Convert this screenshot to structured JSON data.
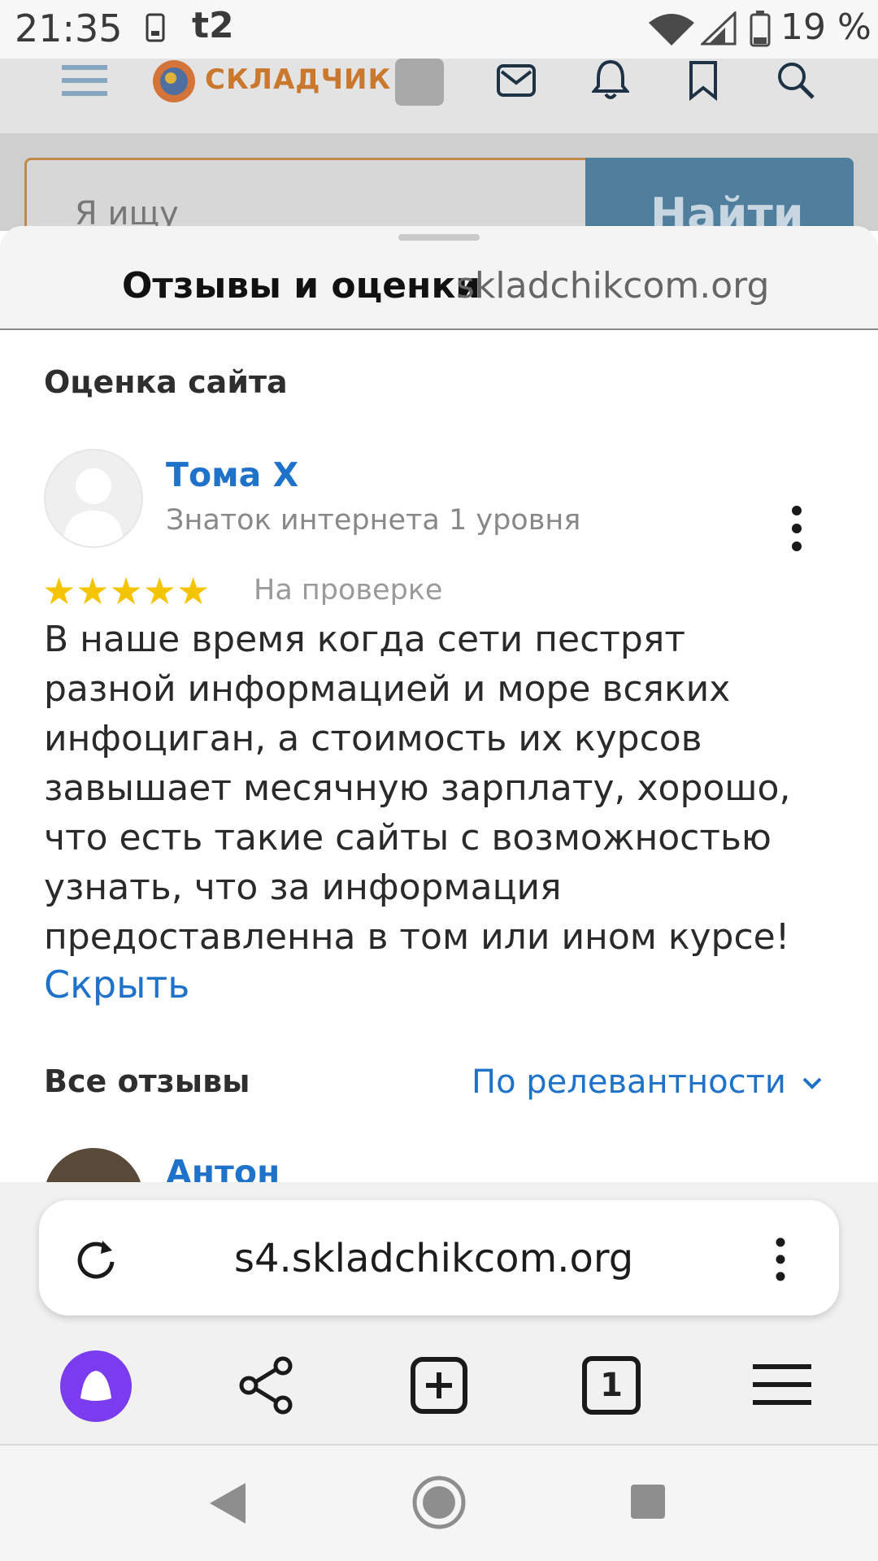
{
  "status_bar": {
    "time": "21:35",
    "carrier": "t2",
    "battery": "19 %"
  },
  "site": {
    "logo_text": "СКЛАДЧИК",
    "search_placeholder": "Я ищу",
    "search_button": "Найти"
  },
  "sheet": {
    "title": "Отзывы и оценки",
    "domain": "skladchikcom.org",
    "rating_section_title": "Оценка сайта",
    "review": {
      "author": "Тома Х",
      "level": "Знаток интернета 1 уровня",
      "stars": 5,
      "stars_display": "★★★★★",
      "status": "На проверке",
      "text": "В наше время когда сети пестрят разной информацией и море всяких инфоциган, а стоимость их курсов завышает месячную зарплату, хорошо, что есть такие сайты с возможностью узнать, что за информация предоставленна в том или ином курсе!",
      "hide_link": "Скрыть"
    },
    "all_reviews_title": "Все отзывы",
    "sort_label": "По релевантности",
    "next_author": "Антон"
  },
  "browser": {
    "url": "s4.skladchikcom.org",
    "tab_count": "1"
  },
  "colors": {
    "link": "#1f72c9",
    "star": "#f5c400",
    "alice": "#7b3cf0"
  }
}
